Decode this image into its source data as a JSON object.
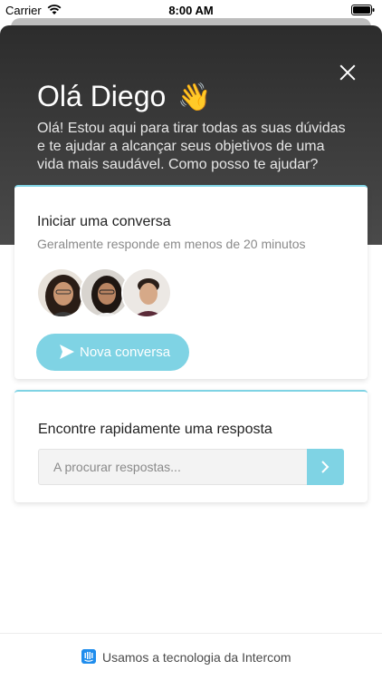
{
  "status_bar": {
    "carrier": "Carrier",
    "time": "8:00 AM"
  },
  "header": {
    "title": "Olá Diego",
    "wave_emoji": "👋",
    "message": "Olá! Estou aqui para tirar todas as suas dúvidas e te ajudar a alcançar seus objetivos de uma vida mais saudável. Como posso te ajudar?"
  },
  "conversation_card": {
    "title": "Iniciar uma conversa",
    "subtitle": "Geralmente responde em menos de 20 minutos",
    "team_avatars": [
      "team-member-1",
      "team-member-2",
      "team-member-3"
    ],
    "button_label": "Nova conversa"
  },
  "search_card": {
    "title": "Encontre rapidamente uma resposta",
    "placeholder": "A procurar respostas..."
  },
  "footer": {
    "label": "Usamos a tecnologia da Intercom"
  },
  "colors": {
    "accent": "#7fd3e4",
    "header_dark": "#2c2c2c",
    "intercom_blue": "#1f8ded"
  }
}
